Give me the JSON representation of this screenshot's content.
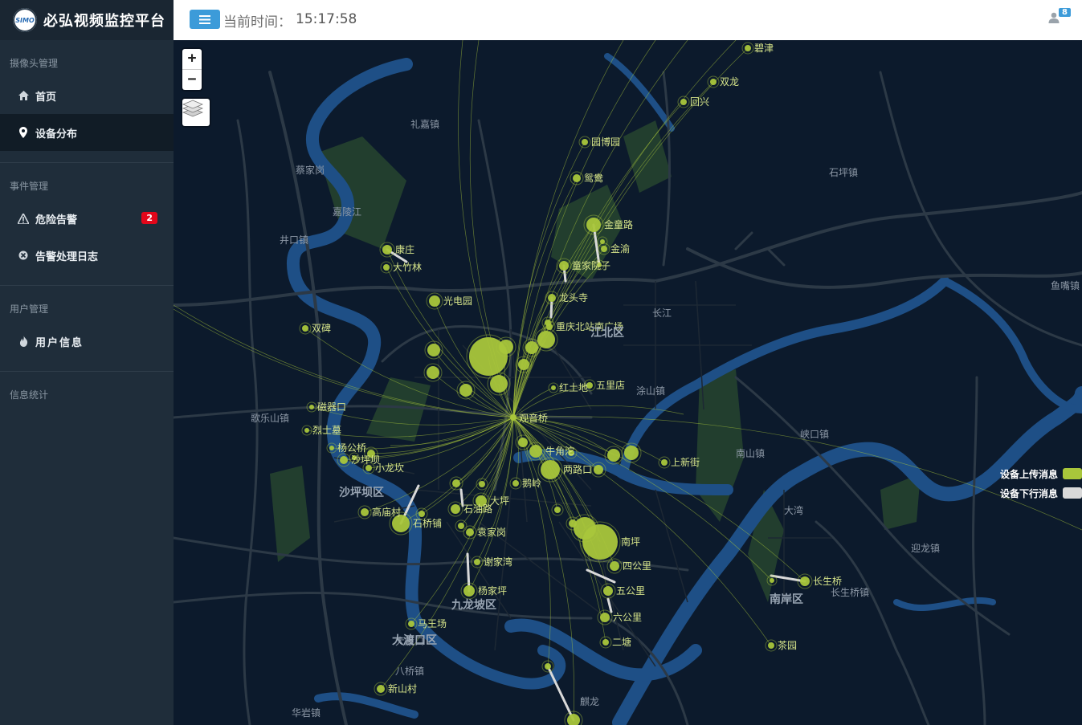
{
  "app": {
    "logo_text": "SIMO",
    "title": "必弘视频监控平台"
  },
  "header": {
    "time_label": "当前时间：",
    "time_value": "15:17:58",
    "notification_count": "8"
  },
  "sidebar": {
    "groups": [
      {
        "label": "摄像头管理",
        "items": [
          {
            "label": "首页",
            "icon": "home-icon"
          },
          {
            "label": "设备分布",
            "icon": "map-marker-icon",
            "active": true
          }
        ]
      },
      {
        "label": "事件管理",
        "items": [
          {
            "label": "危险告警",
            "icon": "warning-icon",
            "badge": "2"
          },
          {
            "label": "告警处理日志",
            "icon": "log-icon"
          }
        ]
      },
      {
        "label": "用户管理",
        "items": [
          {
            "label": "用户信息",
            "icon": "fire-icon"
          }
        ]
      },
      {
        "label": "信息统计",
        "items": []
      }
    ]
  },
  "map": {
    "zoom_in": "+",
    "zoom_out": "−",
    "legend": [
      {
        "label": "设备上传消息",
        "color": "#a9c63b"
      },
      {
        "label": "设备下行消息",
        "color": "#d9d9d9"
      }
    ],
    "hub_label": "观音桥",
    "district_labels": [
      "沙坪坝区",
      "九龙坡区",
      "大渡口区",
      "南岸区",
      "江北区"
    ],
    "place_labels": [
      "碧津",
      "双龙",
      "回兴",
      "礼嘉镇",
      "园博园",
      "鸳鸯",
      "石坪镇",
      "金童路",
      "金渝",
      "童家院子",
      "蔡家岗",
      "嘉陵江",
      "井口镇",
      "康庄",
      "大竹林",
      "光电园",
      "龙头寺",
      "双碑",
      "长江",
      "重庆北站南广场",
      "鱼嘴镇",
      "红土地",
      "五里店",
      "涂山镇",
      "磁器口",
      "歌乐山镇",
      "烈士墓",
      "杨公桥",
      "沙坪坝",
      "小龙坎",
      "牛角沱",
      "两路口",
      "上新街",
      "南山镇",
      "峡口镇",
      "鹅岭",
      "大坪",
      "石油路",
      "石桥铺",
      "高庙村",
      "袁家岗",
      "谢家湾",
      "杨家坪",
      "南坪",
      "四公里",
      "五公里",
      "六公里",
      "二塘",
      "长生桥",
      "茶园",
      "大渡口",
      "马王场",
      "八桥镇",
      "新山村",
      "麒龙",
      "华岩镇",
      "迎龙镇",
      "大湾",
      "长生桥镇"
    ]
  }
}
